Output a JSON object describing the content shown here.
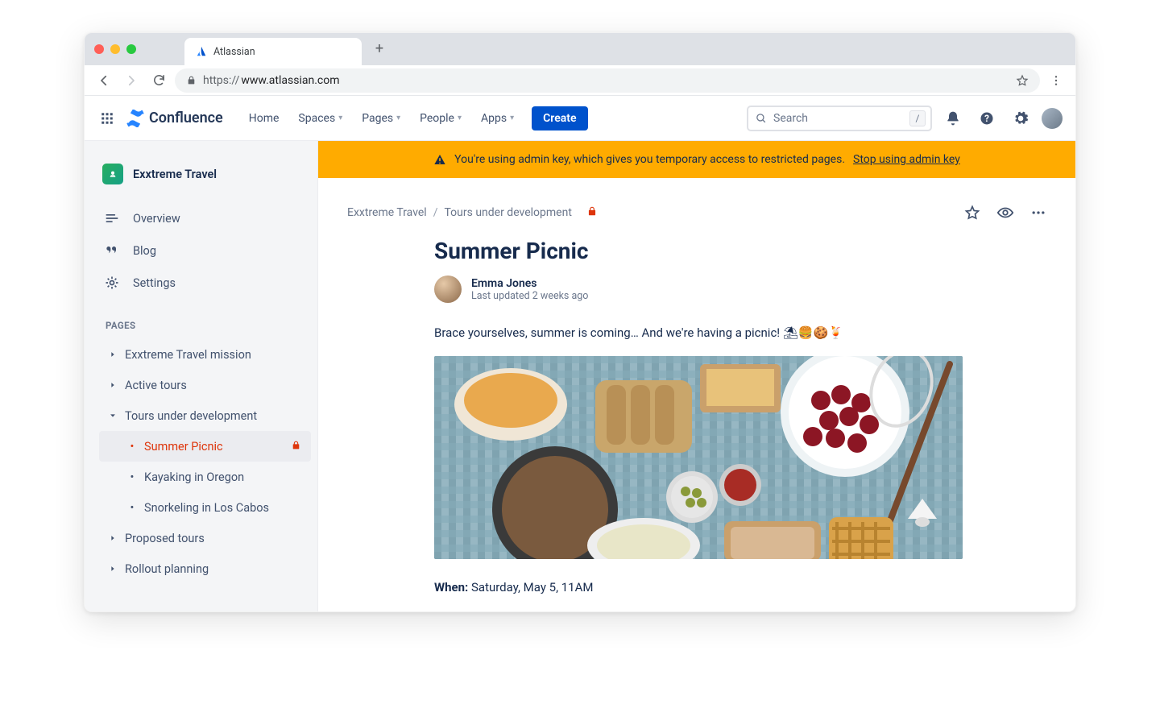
{
  "browser": {
    "tab_title": "Atlassian",
    "url_scheme": "https://",
    "url_host": "www.atlassian.com"
  },
  "header": {
    "product": "Confluence",
    "nav": {
      "home": "Home",
      "spaces": "Spaces",
      "pages": "Pages",
      "people": "People",
      "apps": "Apps"
    },
    "create": "Create",
    "search_placeholder": "Search",
    "search_key": "/"
  },
  "banner": {
    "text": "You're using admin key, which gives you temporary access to restricted pages.",
    "link": "Stop using admin key"
  },
  "sidebar": {
    "space": "Exxtreme Travel",
    "overview": "Overview",
    "blog": "Blog",
    "settings": "Settings",
    "pages_heading": "PAGES",
    "tree": {
      "mission": "Exxtreme Travel mission",
      "active": "Active tours",
      "dev": "Tours under development",
      "dev_children": {
        "summer": "Summer Picnic",
        "kayaking": "Kayaking in Oregon",
        "snorkel": "Snorkeling in Los Cabos"
      },
      "proposed": "Proposed tours",
      "rollout": "Rollout planning"
    }
  },
  "page": {
    "breadcrumb_space": "Exxtreme Travel",
    "breadcrumb_parent": "Tours under development",
    "title": "Summer Picnic",
    "author": "Emma Jones",
    "updated": "Last updated 2 weeks ago",
    "intro": "Brace yourselves, summer is coming… And we're having a picnic! ⛱🍔🍪🍹",
    "when_label": "When:",
    "when_value": "Saturday, May 5, 11AM"
  }
}
